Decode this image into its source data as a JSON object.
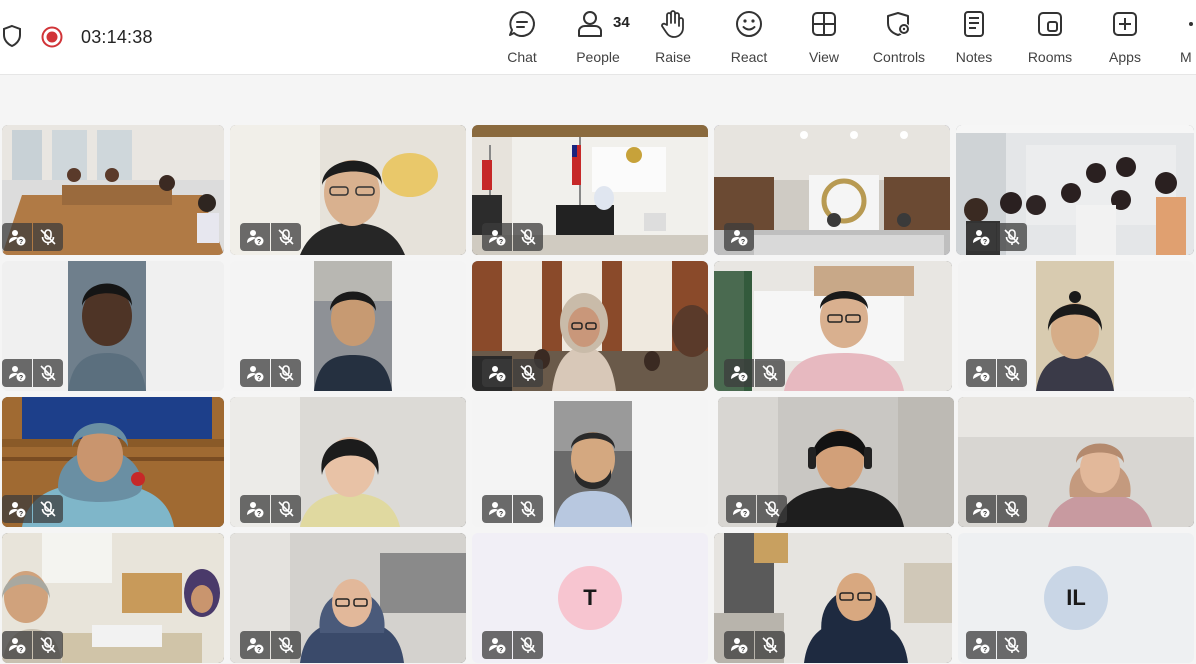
{
  "call": {
    "timer": "03:14:38",
    "people_count": "34"
  },
  "toolbar": {
    "chat": "Chat",
    "people": "People",
    "raise": "Raise",
    "react": "React",
    "view": "View",
    "controls": "Controls",
    "notes": "Notes",
    "rooms": "Rooms",
    "apps": "Apps",
    "more": "M"
  },
  "icons": {
    "shield": "shield-icon",
    "record": "record-icon",
    "chat": "chat-icon",
    "people": "people-icon",
    "raise": "hand-icon",
    "react": "smiley-icon",
    "view": "grid-icon",
    "controls": "gear-shield-icon",
    "notes": "notes-icon",
    "rooms": "rooms-icon",
    "apps": "plus-icon",
    "participant_unknown": "person-question-icon",
    "muted": "mic-off-icon"
  },
  "colors": {
    "accent": "#5b5fc7",
    "record_red": "#d13438",
    "avatar_pink": "#f7c5d0",
    "avatar_blue": "#c9d6e6"
  },
  "participants": [
    {
      "id": "p1",
      "type": "video",
      "muted": true
    },
    {
      "id": "p2",
      "type": "video",
      "muted": true
    },
    {
      "id": "p3",
      "type": "video",
      "muted": true
    },
    {
      "id": "p4",
      "type": "video",
      "muted": false,
      "selected": true
    },
    {
      "id": "p5",
      "type": "video",
      "muted": true
    },
    {
      "id": "p6",
      "type": "video",
      "muted": true
    },
    {
      "id": "p7",
      "type": "video",
      "muted": true
    },
    {
      "id": "p8",
      "type": "video",
      "muted": true
    },
    {
      "id": "p9",
      "type": "video",
      "muted": true
    },
    {
      "id": "p10",
      "type": "video",
      "muted": true
    },
    {
      "id": "p11",
      "type": "video",
      "muted": true
    },
    {
      "id": "p12",
      "type": "video",
      "muted": true
    },
    {
      "id": "p13",
      "type": "video",
      "muted": true
    },
    {
      "id": "p14",
      "type": "video",
      "muted": true
    },
    {
      "id": "p15",
      "type": "video",
      "muted": true
    },
    {
      "id": "p16",
      "type": "video",
      "muted": false
    },
    {
      "id": "p17",
      "type": "video",
      "muted": true
    },
    {
      "id": "p18",
      "type": "avatar",
      "initials": "T",
      "muted": true
    },
    {
      "id": "p19",
      "type": "video",
      "muted": true
    },
    {
      "id": "p20",
      "type": "avatar",
      "initials": "IL",
      "muted": true
    }
  ]
}
